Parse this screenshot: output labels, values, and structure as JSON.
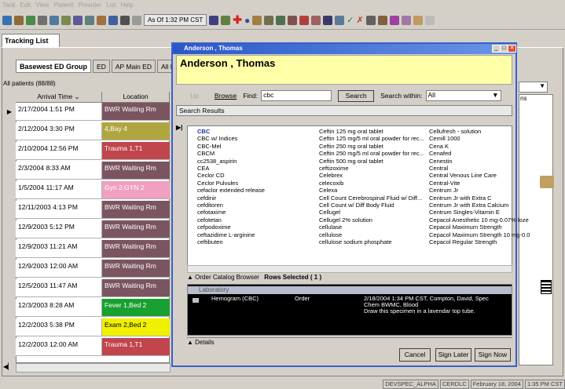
{
  "menu": [
    "Task",
    "Edit",
    "View",
    "Patient",
    "Provider",
    "List",
    "Help"
  ],
  "toolbar": {
    "asof": "As Of 1:32 PM CST"
  },
  "tracking_tab": "Tracking List",
  "subtabs": [
    "Basewest ED Group",
    "ED",
    "AP Main ED",
    "All ED Be"
  ],
  "all_patients": "All patients (88/88)",
  "columns": {
    "arrival": "Arrival Time",
    "location": "Location"
  },
  "rows": [
    {
      "time": "2/17/2004 1:51 PM",
      "loc": "BWR Waiting Rm",
      "color": "#7a5560"
    },
    {
      "time": "2/12/2004 3:30 PM",
      "loc": "4,Bay 4",
      "color": "#b0a640"
    },
    {
      "time": "2/10/2004 12:56 PM",
      "loc": "Trauma 1,T1",
      "color": "#c0454c"
    },
    {
      "time": "2/3/2004 8:33 AM",
      "loc": "BWR Waiting Rm",
      "color": "#7a5560"
    },
    {
      "time": "1/5/2004 11:17 AM",
      "loc": "Gyn 2,GYN 2",
      "color": "#f0a0c0"
    },
    {
      "time": "12/11/2003 4:13 PM",
      "loc": "BWR Waiting Rm",
      "color": "#7a5560"
    },
    {
      "time": "12/9/2003 5:12 PM",
      "loc": "BWR Waiting Rm",
      "color": "#7a5560"
    },
    {
      "time": "12/9/2003 11:21 AM",
      "loc": "BWR Waiting Rm",
      "color": "#7a5560"
    },
    {
      "time": "12/9/2003 12:00 AM",
      "loc": "BWR Waiting Rm",
      "color": "#7a5560"
    },
    {
      "time": "12/5/2003 11:47 AM",
      "loc": "BWR Waiting Rm",
      "color": "#7a5560"
    },
    {
      "time": "12/3/2003 8:28 AM",
      "loc": "Fever 1,Bed 2",
      "color": "#18a030"
    },
    {
      "time": "12/2/2003 5:38 PM",
      "loc": "Exam 2,Bed 2",
      "color": "#f0f000"
    },
    {
      "time": "12/2/2003 12:00 AM",
      "loc": "Trauma 1,T1",
      "color": "#c0454c"
    }
  ],
  "dialog": {
    "title": "Anderson , Thomas",
    "banner_name": "Anderson , Thomas",
    "up": "Up",
    "browse": "Browse",
    "find_label": "Find:",
    "find_value": "cbc",
    "search_btn": "Search",
    "search_within_label": "Search within:",
    "search_within_value": "All",
    "search_results": "Search Results",
    "col1": [
      "CBC",
      "CBC w/ Indices",
      "CBC-Mel",
      "CBCM",
      "cc2538_aspirin",
      "CEA",
      "Ceclor CD",
      "Ceclor Pulvules",
      "cefaclor extended release",
      "cefdinir",
      "cefditoren",
      "cefotaxime",
      "cefotetan",
      "cefpodoxime",
      "ceftazidime L-arginine",
      "ceftibuten"
    ],
    "col2": [
      "Ceftin 125 mg oral tablet",
      "Ceftin 125 mg/5 ml oral powder for rec...",
      "Ceftin 250 mg oral tablet",
      "Ceftin 250 mg/5 ml oral powder for rec...",
      "Ceftin 500 mg oral tablet",
      "ceftizoxime",
      "Celebrex",
      "celecoxib",
      "Celexa",
      "Cell Count Cerebrospinal Fluid w/ Diff...",
      "Cell Count w/ Diff Body Fluid",
      "Cellugel",
      "Cellugel 2% solution",
      "cellulase",
      "cellulose",
      "cellulose sodium phosphate"
    ],
    "col3": [
      "Cellufresh - solution",
      "Cemill 1000",
      "Cena K",
      "Cenafed",
      "Cenestin",
      "Central",
      "Central Venous Line Care",
      "Central-Vite",
      "Centrum Jr",
      "Centrum Jr with Extra C",
      "Centrum Jr with Extra Calcium",
      "Centrum Singles-Vitamin E",
      "Cepacol Anesthetic 10 mg-0.07% loze",
      "Cepacol Maximum Strength",
      "Cepacol Maximum Strength 10 mg-0.0",
      "Cepacol Regular Strength"
    ],
    "ocb_label": "Order Catalog Browser",
    "rows_selected": "Rows Selected ( 1 )",
    "order_group": "Laboratory",
    "order_name": "Hemogram (CBC)",
    "order_type": "Order",
    "order_detail1": "2/18/2004 1:34 PM CST, Compton, David, Spec",
    "order_detail2": "Chem BWMC, Blood",
    "order_detail3": "Draw this specimen in a lavendar top tube.",
    "details": "Details",
    "cancel": "Cancel",
    "sign_later": "Sign Later",
    "sign_now": "Sign Now"
  },
  "right_col_hdr": "ns",
  "status": [
    "DEVSPEC_ALPHA",
    "CERDLC",
    "February 18, 2004",
    "1:35 PM CST"
  ]
}
